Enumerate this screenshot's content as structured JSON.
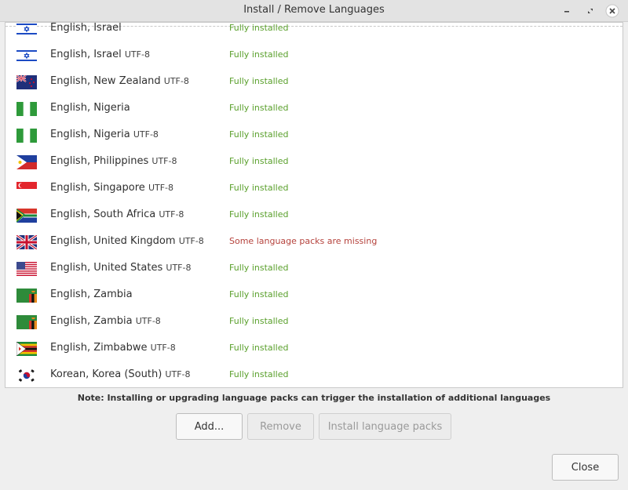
{
  "window": {
    "title": "Install / Remove Languages"
  },
  "colors": {
    "installed": "#5aa02c",
    "missing": "#b5423c"
  },
  "languages": [
    {
      "name": "English, Israel",
      "encoding": "",
      "status": "Fully installed",
      "status_kind": "installed",
      "flag": "israel-flag-icon"
    },
    {
      "name": "English, Israel",
      "encoding": "UTF-8",
      "status": "Fully installed",
      "status_kind": "installed",
      "flag": "israel-flag-icon"
    },
    {
      "name": "English, New Zealand",
      "encoding": "UTF-8",
      "status": "Fully installed",
      "status_kind": "installed",
      "flag": "new-zealand-flag-icon"
    },
    {
      "name": "English, Nigeria",
      "encoding": "",
      "status": "Fully installed",
      "status_kind": "installed",
      "flag": "nigeria-flag-icon"
    },
    {
      "name": "English, Nigeria",
      "encoding": "UTF-8",
      "status": "Fully installed",
      "status_kind": "installed",
      "flag": "nigeria-flag-icon"
    },
    {
      "name": "English, Philippines",
      "encoding": "UTF-8",
      "status": "Fully installed",
      "status_kind": "installed",
      "flag": "philippines-flag-icon"
    },
    {
      "name": "English, Singapore",
      "encoding": "UTF-8",
      "status": "Fully installed",
      "status_kind": "installed",
      "flag": "singapore-flag-icon"
    },
    {
      "name": "English, South Africa",
      "encoding": "UTF-8",
      "status": "Fully installed",
      "status_kind": "installed",
      "flag": "south-africa-flag-icon"
    },
    {
      "name": "English, United Kingdom",
      "encoding": "UTF-8",
      "status": "Some language packs are missing",
      "status_kind": "missing",
      "flag": "united-kingdom-flag-icon"
    },
    {
      "name": "English, United States",
      "encoding": "UTF-8",
      "status": "Fully installed",
      "status_kind": "installed",
      "flag": "united-states-flag-icon"
    },
    {
      "name": "English, Zambia",
      "encoding": "",
      "status": "Fully installed",
      "status_kind": "installed",
      "flag": "zambia-flag-icon"
    },
    {
      "name": "English, Zambia",
      "encoding": "UTF-8",
      "status": "Fully installed",
      "status_kind": "installed",
      "flag": "zambia-flag-icon"
    },
    {
      "name": "English, Zimbabwe",
      "encoding": "UTF-8",
      "status": "Fully installed",
      "status_kind": "installed",
      "flag": "zimbabwe-flag-icon"
    },
    {
      "name": "Korean, Korea (South)",
      "encoding": "UTF-8",
      "status": "Fully installed",
      "status_kind": "installed",
      "flag": "south-korea-flag-icon"
    }
  ],
  "note": "Note: Installing or upgrading language packs can trigger the installation of additional languages",
  "buttons": {
    "add": "Add...",
    "remove": "Remove",
    "install": "Install language packs",
    "close": "Close"
  }
}
